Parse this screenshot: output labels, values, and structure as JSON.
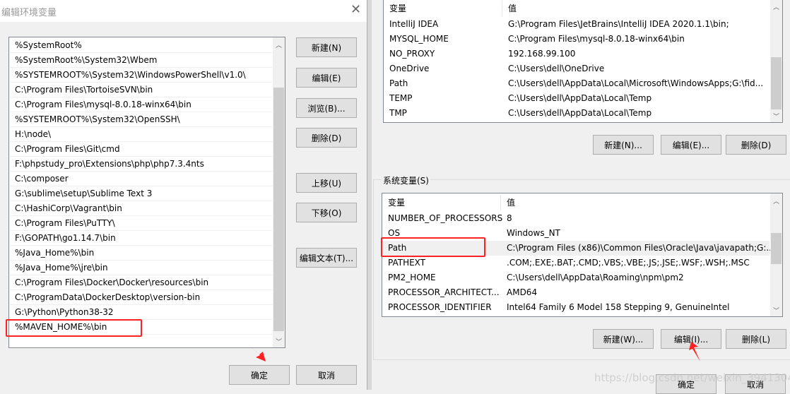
{
  "edit_dialog": {
    "title": "编辑环境变量",
    "entries": [
      "%SystemRoot%",
      "%SystemRoot%\\System32\\Wbem",
      "%SYSTEMROOT%\\System32\\WindowsPowerShell\\v1.0\\",
      "C:\\Program Files\\TortoiseSVN\\bin",
      "C:\\Program Files\\mysql-8.0.18-winx64\\bin",
      "%SYSTEMROOT%\\System32\\OpenSSH\\",
      "H:\\node\\",
      "C:\\Program Files\\Git\\cmd",
      "F:\\phpstudy_pro\\Extensions\\php\\php7.3.4nts",
      "C:\\composer",
      "G:\\sublime\\setup\\Sublime Text 3",
      "C:\\HashiCorp\\Vagrant\\bin",
      "C:\\Program Files\\PuTTY\\",
      "F:\\GOPATH\\go1.14.7\\bin",
      "%Java_Home%\\bin",
      "%Java_Home%\\jre\\bin",
      "C:\\Program Files\\Docker\\Docker\\resources\\bin",
      "C:\\ProgramData\\DockerDesktop\\version-bin",
      "G:\\Python\\Python38-32",
      "%MAVEN_HOME%\\bin"
    ],
    "buttons": {
      "new": "新建(N)",
      "edit": "编辑(E)",
      "browse": "浏览(B)...",
      "delete": "删除(D)",
      "up": "上移(U)",
      "down": "下移(O)",
      "edit_text": "编辑文本(T)...",
      "ok": "确定",
      "cancel": "取消"
    }
  },
  "env_dialog": {
    "user_table": {
      "headers": [
        "变量",
        "值"
      ],
      "rows": [
        [
          "IntelliJ IDEA",
          "G:\\Program Files\\JetBrains\\IntelliJ IDEA 2020.1.1\\bin;"
        ],
        [
          "MYSQL_HOME",
          "C:\\Program Files\\mysql-8.0.18-winx64\\bin"
        ],
        [
          "NO_PROXY",
          "192.168.99.100"
        ],
        [
          "OneDrive",
          "C:\\Users\\dell\\OneDrive"
        ],
        [
          "Path",
          "C:\\Users\\dell\\AppData\\Local\\Microsoft\\WindowsApps;G:\\fid..."
        ],
        [
          "TEMP",
          "C:\\Users\\dell\\AppData\\Local\\Temp"
        ],
        [
          "TMP",
          "C:\\Users\\dell\\AppData\\Local\\Temp"
        ]
      ]
    },
    "user_buttons": {
      "new": "新建(N)...",
      "edit": "编辑(E)...",
      "delete": "删除(D)"
    },
    "system_group_label": "系统变量(S)",
    "system_table": {
      "headers": [
        "变量",
        "值"
      ],
      "rows": [
        [
          "NUMBER_OF_PROCESSORS",
          "8"
        ],
        [
          "OS",
          "Windows_NT"
        ],
        [
          "Path",
          "C:\\Program Files (x86)\\Common Files\\Oracle\\Java\\javapath;G:..."
        ],
        [
          "PATHEXT",
          ".COM;.EXE;.BAT;.CMD;.VBS;.VBE;.JS;.JSE;.WSF;.WSH;.MSC"
        ],
        [
          "PM2_HOME",
          "C:\\Users\\dell\\AppData\\Roaming\\npm\\pm2"
        ],
        [
          "PROCESSOR_ARCHITECT...",
          "AMD64"
        ],
        [
          "PROCESSOR_IDENTIFIER",
          "Intel64 Family 6 Model 158 Stepping 9, GenuineIntel"
        ]
      ],
      "selected_row": 2
    },
    "system_buttons": {
      "new": "新建(W)...",
      "edit": "编辑(I)...",
      "delete": "删除(L)"
    },
    "ok": "确定",
    "cancel": "取消"
  },
  "watermark": "https://blog.csdn.net/weixin_39413049",
  "colors": {
    "highlight": "#ff2222",
    "button_bg": "#e1e1e1",
    "dialog_bg": "#f0f0f0"
  }
}
